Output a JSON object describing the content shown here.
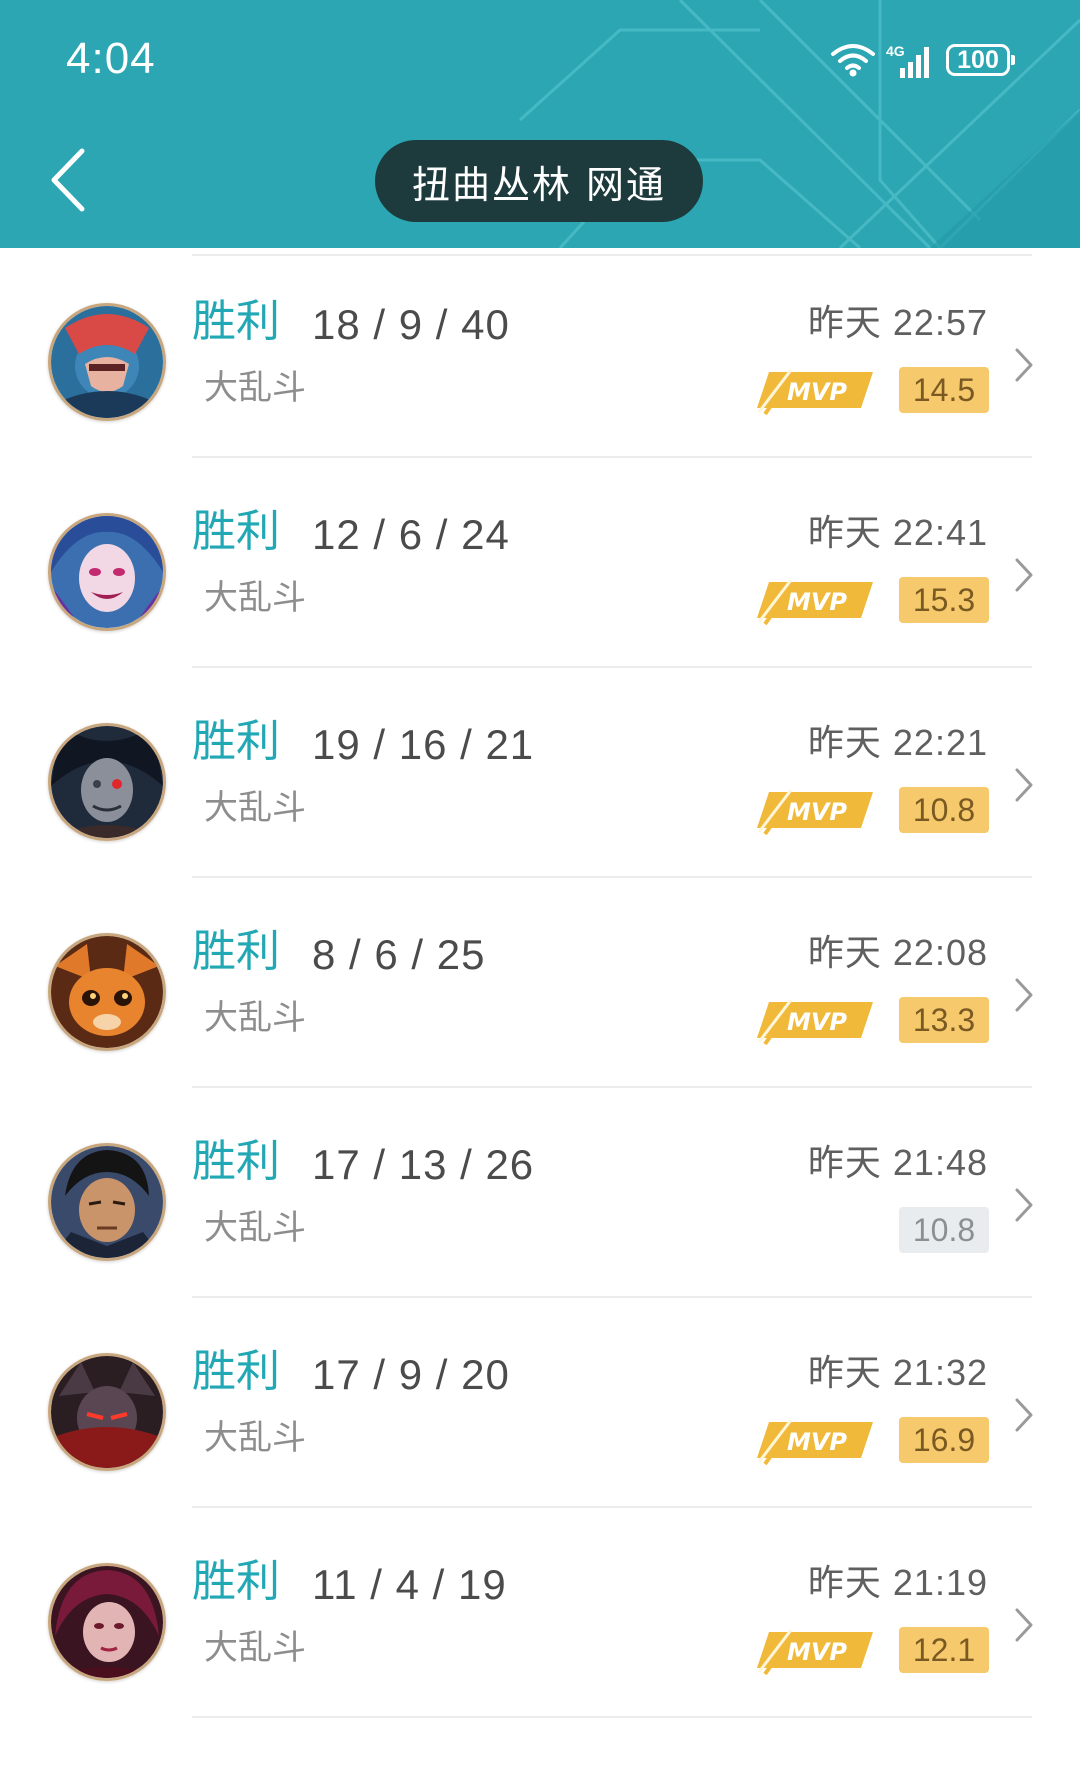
{
  "status": {
    "time": "4:04",
    "network": "4G",
    "battery": "100"
  },
  "header": {
    "title": "扭曲丛林 网通"
  },
  "colors": {
    "header_bg": "#2ba6b2",
    "result_text": "#22a7b4",
    "score_gold": "#f6c96d",
    "score_grey": "#e8ecef",
    "mvp_gold": "#f0b93a"
  },
  "icons": {
    "back": "back-arrow-icon",
    "wifi": "wifi-icon",
    "signal": "signal-icon",
    "battery": "battery-icon",
    "mvp": "mvp-badge-icon",
    "chevron": "chevron-right-icon"
  },
  "matches": [
    {
      "result": "胜利",
      "kda": "18 / 9 / 40",
      "mode": "大乱斗",
      "time": "昨天 22:57",
      "mvp": true,
      "score": "14.5",
      "champion": "red-masked-warrior"
    },
    {
      "result": "胜利",
      "kda": "12 / 6 / 24",
      "mode": "大乱斗",
      "time": "昨天 22:41",
      "mvp": true,
      "score": "15.3",
      "champion": "blue-haired-girl"
    },
    {
      "result": "胜利",
      "kda": "19 / 16 / 21",
      "mode": "大乱斗",
      "time": "昨天 22:21",
      "mvp": true,
      "score": "10.8",
      "champion": "dark-hunter"
    },
    {
      "result": "胜利",
      "kda": "8 / 6 / 25",
      "mode": "大乱斗",
      "time": "昨天 22:08",
      "mvp": true,
      "score": "13.3",
      "champion": "orange-yordle"
    },
    {
      "result": "胜利",
      "kda": "17 / 13 / 26",
      "mode": "大乱斗",
      "time": "昨天 21:48",
      "mvp": false,
      "score": "10.8",
      "champion": "black-haired-swordsman"
    },
    {
      "result": "胜利",
      "kda": "17 / 9 / 20",
      "mode": "大乱斗",
      "time": "昨天 21:32",
      "mvp": true,
      "score": "16.9",
      "champion": "dark-armored-blade"
    },
    {
      "result": "胜利",
      "kda": "11 / 4 / 19",
      "mode": "大乱斗",
      "time": "昨天 21:19",
      "mvp": true,
      "score": "12.1",
      "champion": "crimson-hooded-rebel"
    }
  ]
}
